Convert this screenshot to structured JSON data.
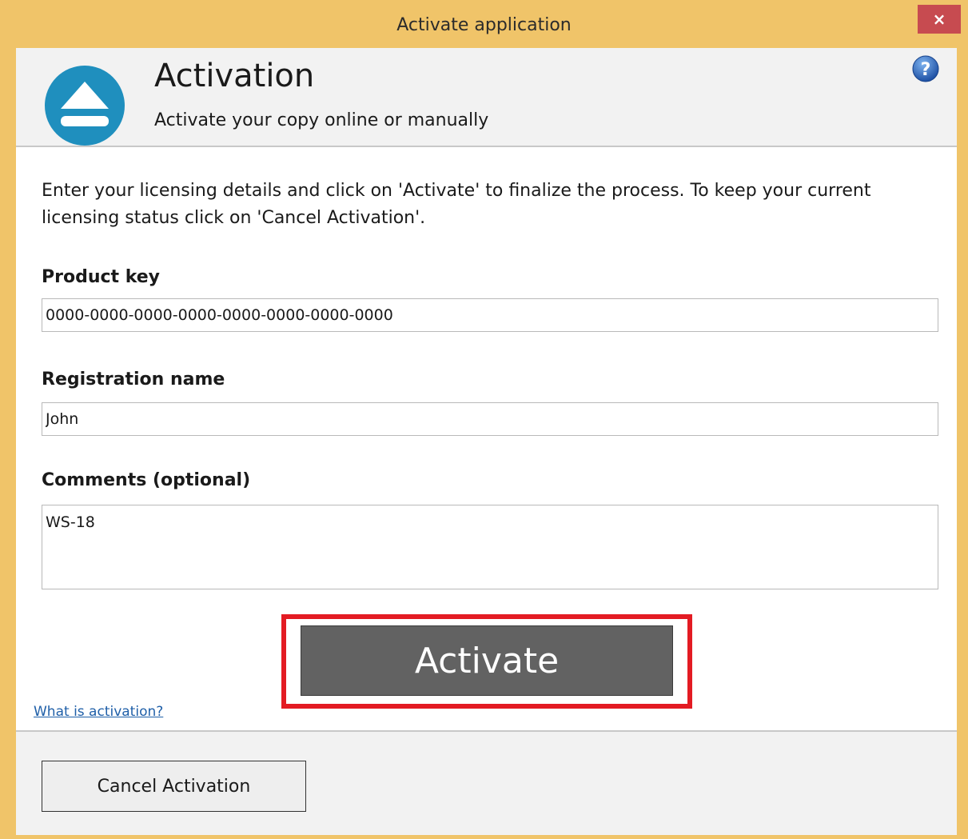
{
  "window": {
    "title": "Activate application",
    "close_label": "×"
  },
  "header": {
    "title": "Activation",
    "subtitle": "Activate your copy online or manually",
    "logo_icon": "eject-icon",
    "help_icon": "help-question-icon"
  },
  "intro": {
    "text": "Enter your licensing details and click on 'Activate' to finalize the process. To keep your current licensing status click on 'Cancel Activation'."
  },
  "form": {
    "product_key": {
      "label": "Product key",
      "value": "0000-0000-0000-0000-0000-0000-0000-0000"
    },
    "registration_name": {
      "label": "Registration name",
      "value": "John"
    },
    "comments": {
      "label": "Comments (optional)",
      "value": "WS-18"
    }
  },
  "actions": {
    "activate_label": "Activate",
    "help_link": "What is activation?",
    "cancel_label": "Cancel Activation"
  },
  "colors": {
    "titlebar": "#f0c469",
    "close_button": "#c74b50",
    "logo": "#1f8fbe",
    "highlight": "#e31b23",
    "activate_button": "#626262"
  }
}
